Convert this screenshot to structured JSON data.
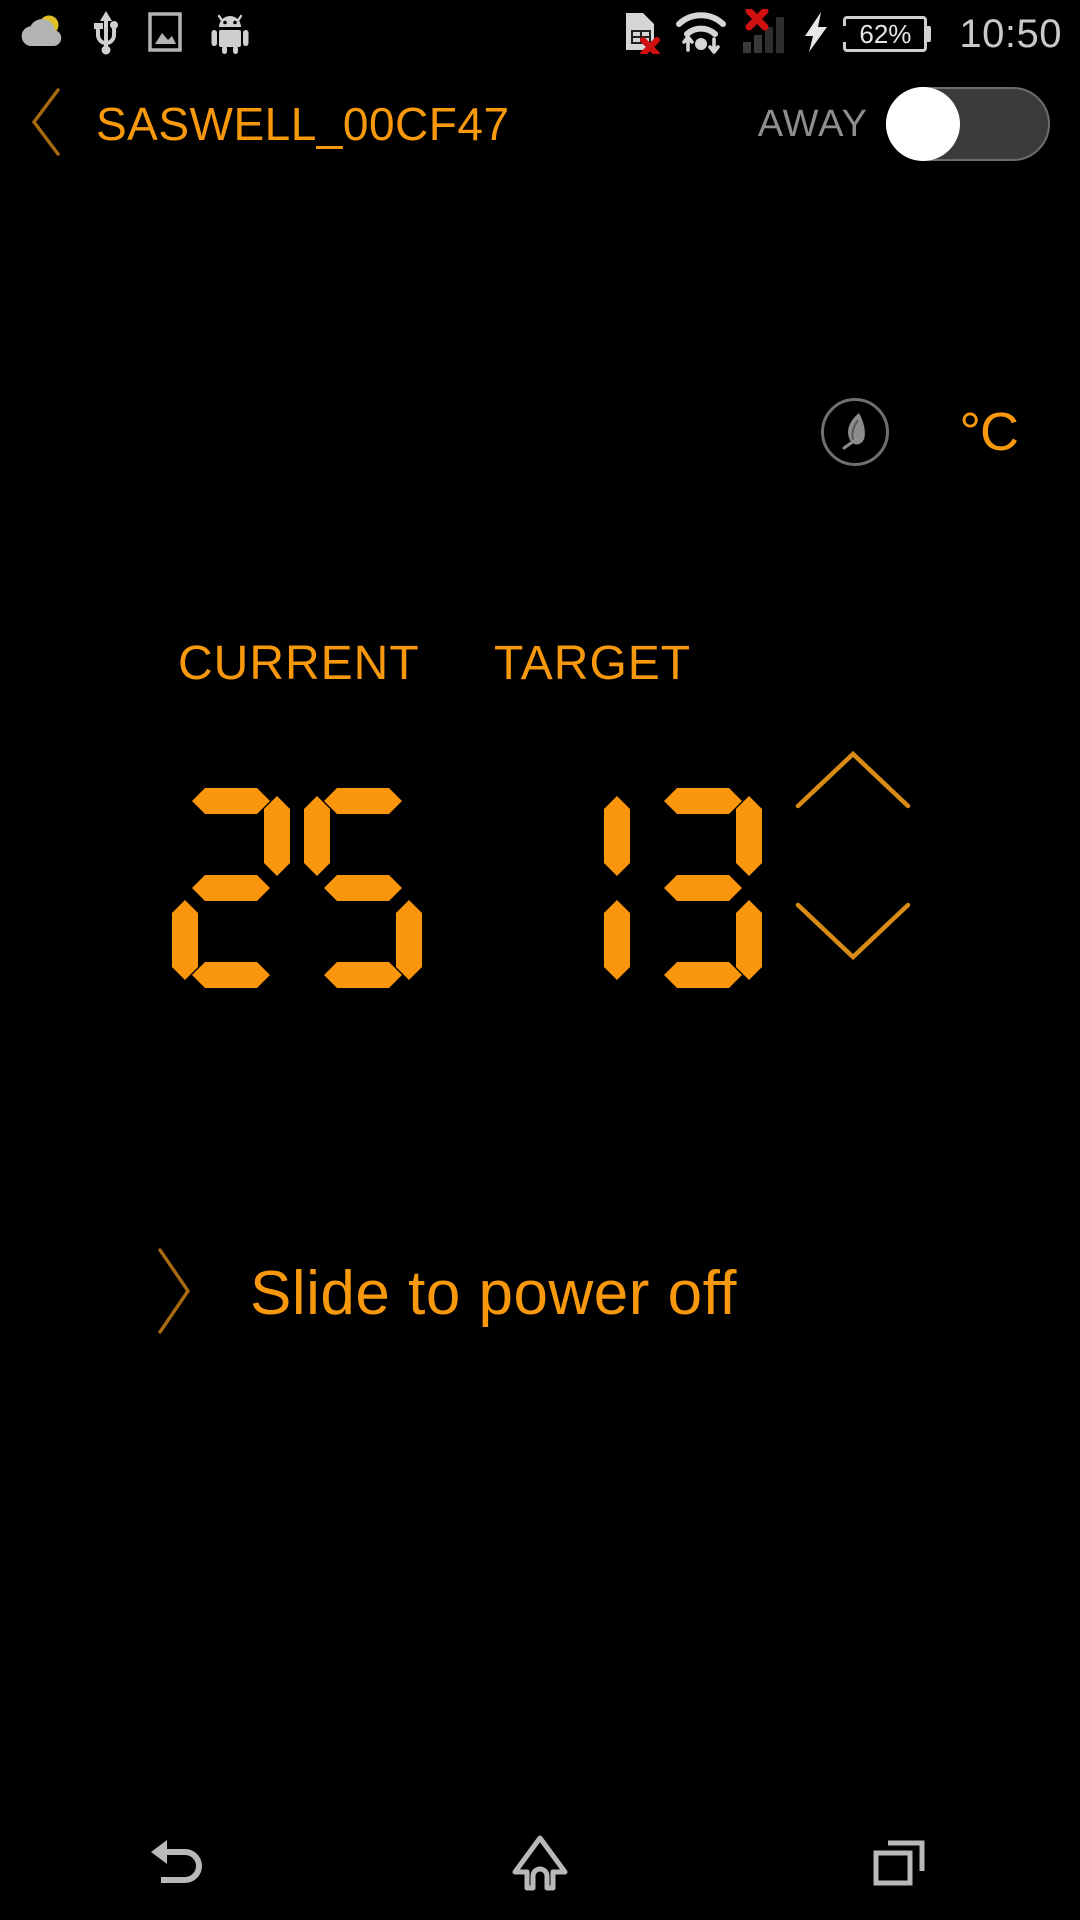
{
  "statusbar": {
    "left_icons": [
      {
        "name": "weather-cloud-sun-icon",
        "label": "weather"
      },
      {
        "name": "usb-icon",
        "label": "usb"
      },
      {
        "name": "screenshot-image-icon",
        "label": "screenshot"
      },
      {
        "name": "android-icon",
        "label": "android"
      }
    ],
    "right_icons": [
      {
        "name": "sim-card-error-icon",
        "label": "no sim"
      },
      {
        "name": "wifi-transfer-icon",
        "label": "wifi"
      },
      {
        "name": "mobile-signal-error-icon",
        "label": "no signal"
      },
      {
        "name": "charging-bolt-icon",
        "label": "charging"
      }
    ],
    "battery_percent": "62%",
    "clock": "10:50"
  },
  "titlebar": {
    "back_icon": "chevron-left-icon",
    "device_name": "SASWELL_00CF47",
    "away_label": "AWAY",
    "away_state": "off"
  },
  "mode": {
    "flame_icon": "flame-leaf-icon",
    "flame_active": false,
    "unit": "°C"
  },
  "readout": {
    "current_label": "CURRENT",
    "target_label": "TARGET",
    "current_value": "25",
    "target_value": "13",
    "current_digits": [
      "2",
      "5"
    ],
    "target_digits": [
      "1",
      "3"
    ],
    "stepper_up_icon": "chevron-up-icon",
    "stepper_down_icon": "chevron-down-icon"
  },
  "power": {
    "chevron_icon": "chevron-right-icon",
    "slide_label": "Slide to power off"
  },
  "navbar": {
    "back": "back-icon",
    "home": "home-icon",
    "recents": "recents-icon"
  },
  "colors": {
    "accent_orange": "#f8990d",
    "segment_orange": "#f9960b",
    "background": "#000000",
    "muted_gray": "#8e8e8e",
    "status_gray": "#c9c9c9"
  }
}
